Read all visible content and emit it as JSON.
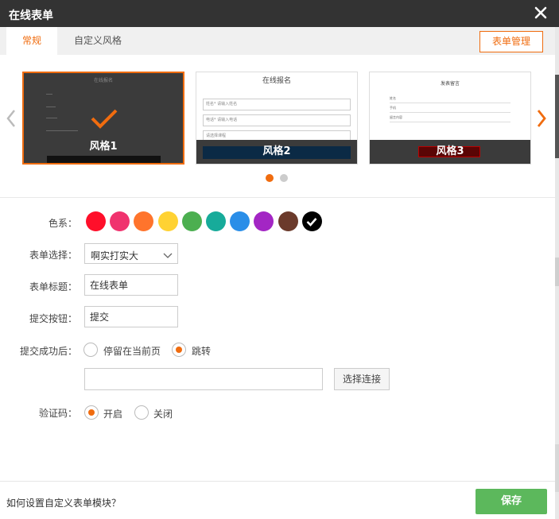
{
  "dialog": {
    "title": "在线表单"
  },
  "tabs": {
    "general": "常规",
    "custom_style": "自定义风格"
  },
  "toolbar": {
    "manage_label": "表单管理"
  },
  "styles": [
    {
      "caption": "风格1",
      "preview_title": "在线报名",
      "selected": true
    },
    {
      "caption": "风格2",
      "preview_title": "在线报名",
      "field1": "姓名*",
      "field1_placeholder": "请输入姓名",
      "field2": "电话*",
      "field2_placeholder": "请输入电话",
      "field3": "请选择课程"
    },
    {
      "caption": "风格3",
      "preview_title": "发表留言",
      "field1": "姓名",
      "field2": "手机",
      "field3": "留言内容"
    }
  ],
  "colors": {
    "accent": "#f06c0f",
    "label": "色系：",
    "swatches": [
      "#ff0f2a",
      "#f0336e",
      "#ff742c",
      "#ffd233",
      "#4caf50",
      "#17ab9a",
      "#2a8ee8",
      "#a326c4",
      "#6b3a2b",
      "#000000"
    ],
    "selected_index": 9
  },
  "form": {
    "select_label": "表单选择：",
    "select_value": "啊实打实大",
    "title_label": "表单标题：",
    "title_value": "在线表单",
    "submit_label": "提交按钮：",
    "submit_value": "提交",
    "after_label": "提交成功后：",
    "after_opt1": "停留在当前页",
    "after_opt2": "跳转",
    "after_selected": "跳转",
    "link_button": "选择连接",
    "captcha_label": "验证码：",
    "captcha_on": "开启",
    "captcha_off": "关闭",
    "captcha_selected": "开启"
  },
  "footer": {
    "help": "如何设置自定义表单模块？",
    "save": "保存"
  }
}
